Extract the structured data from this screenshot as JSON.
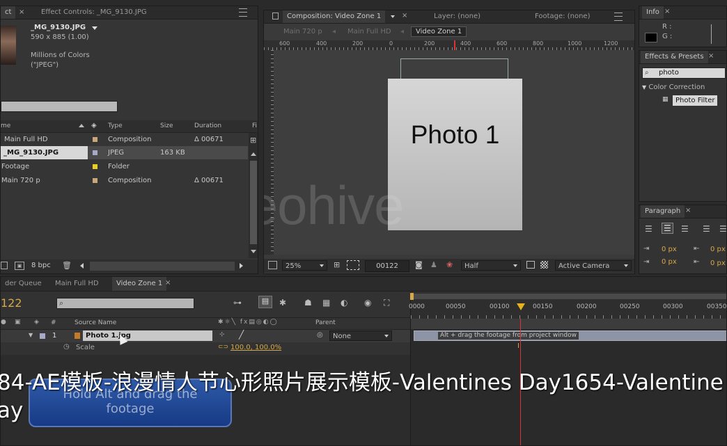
{
  "project_panel": {
    "tab_label": "ct",
    "effect_controls_tab": "Effect Controls: _MG_9130.JPG",
    "footage_name": "_MG_9130.JPG",
    "footage_dims": "590 x 885 (1.00)",
    "footage_colors": "Millions of Colors",
    "footage_format": "(\"JPEG\")",
    "columns": {
      "name": "me",
      "type": "Type",
      "size": "Size",
      "duration": "Duration",
      "fi": "Fi"
    },
    "items": [
      {
        "name": "Main Full HD",
        "type": "Composition",
        "size": "",
        "duration": "Δ 00671",
        "color": "#c8a878"
      },
      {
        "name": "_MG_9130.JPG",
        "type": "JPEG",
        "size": "163 KB",
        "duration": "",
        "color": "#a8a8c8"
      },
      {
        "name": "Footage",
        "type": "Folder",
        "size": "",
        "duration": "",
        "color": "#e8d020"
      },
      {
        "name": "Main 720 p",
        "type": "Composition",
        "size": "",
        "duration": "Δ 00671",
        "color": "#c8a878"
      }
    ],
    "bpc": "8 bpc"
  },
  "composition_panel": {
    "tab_label": "Composition: Video Zone 1",
    "layer_tab": "Layer: (none)",
    "footage_tab": "Footage: (none)",
    "crumbs": [
      "Main 720 p",
      "Main Full HD",
      "Video Zone 1"
    ],
    "ruler_ticks": [
      "600",
      "400",
      "200",
      "0",
      "200",
      "400",
      "600",
      "800",
      "1000",
      "1200"
    ],
    "photo_text": "Photo 1",
    "watermark": "videohive",
    "zoom": "25%",
    "timecode": "00122",
    "resolution": "Half",
    "camera": "Active Camera"
  },
  "info_panel": {
    "tab_label": "Info",
    "r_label": "R :",
    "g_label": "G :"
  },
  "effects_panel": {
    "tab_label": "Effects & Presets",
    "search_value": "photo",
    "category": "Color Correction",
    "effect": "Photo Filter"
  },
  "paragraph_panel": {
    "tab_label": "Paragraph",
    "px1": "0 px",
    "px2": "0 px",
    "px3": "0 px",
    "px4": "0 px"
  },
  "timeline": {
    "tabs": [
      "der Queue",
      "Main Full HD",
      "Video Zone 1"
    ],
    "timecode": "122",
    "columns": {
      "num": "#",
      "source": "Source Name",
      "parent": "Parent"
    },
    "layer": {
      "num": "1",
      "name": "Photo 1.jpg",
      "parent": "None"
    },
    "scale_label": "Scale",
    "scale_value": "100.0, 100.0%",
    "time_ticks": [
      "0000",
      "00050",
      "00100",
      "00150",
      "00200",
      "00250",
      "00300",
      "00350"
    ],
    "bar_text": "Alt + drag the footage from project window"
  },
  "tooltip": {
    "line1": "Hold Alt and drag the",
    "line2": "footage"
  },
  "caption": {
    "line1": "84-AE模板-浪漫情人节心形照片展示模板-Valentines Day1654-Valentine",
    "line2": "ay"
  }
}
